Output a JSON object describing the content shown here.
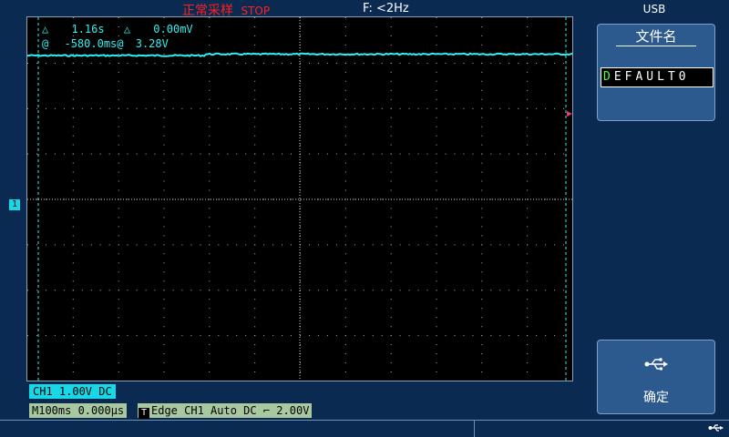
{
  "status": {
    "acquisition": "正常采样",
    "run_state": "STOP",
    "frequency": "F: <2Hz"
  },
  "panel": {
    "title": "USB",
    "filename_label": "文件名",
    "filename_first_char": "D",
    "filename_rest": "EFAULT0",
    "ok_label": "确定"
  },
  "cursors": {
    "delta_symbol": "△",
    "at_symbol": "@",
    "delta_time": "1.16s",
    "delta_voltage": "0.00mV",
    "pos_time": "-580.0ms",
    "pos_voltage": "3.28V"
  },
  "channel": {
    "marker": "1",
    "info": "CH1  1.00V  DC"
  },
  "timebase": {
    "info": "M100ms 0.000μs"
  },
  "trigger": {
    "badge": "T",
    "info": "Edge CH1 Auto DC",
    "slope_symbol": "⌐",
    "level": "2.00V"
  },
  "icons": [
    "usb-icon",
    "usb-status-icon"
  ],
  "colors": {
    "trace": "#2ff0f0",
    "status_red": "#ff2020",
    "background": "#0a2a52"
  }
}
